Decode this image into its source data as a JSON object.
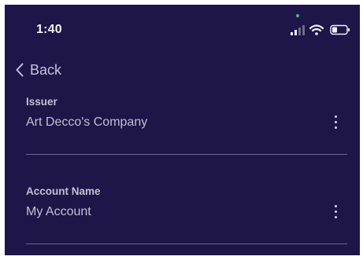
{
  "status_bar": {
    "time": "1:40",
    "icons": [
      "cellular-signal-icon",
      "wifi-icon",
      "battery-icon"
    ]
  },
  "nav": {
    "back_label": "Back"
  },
  "fields": [
    {
      "label": "Issuer",
      "value": "Art Decco's Company"
    },
    {
      "label": "Account Name",
      "value": "My Account"
    }
  ],
  "colors": {
    "background": "#1e1549",
    "text": "#c2c0d4",
    "divider": "#6a6794",
    "accent_dot": "#3fc071"
  }
}
